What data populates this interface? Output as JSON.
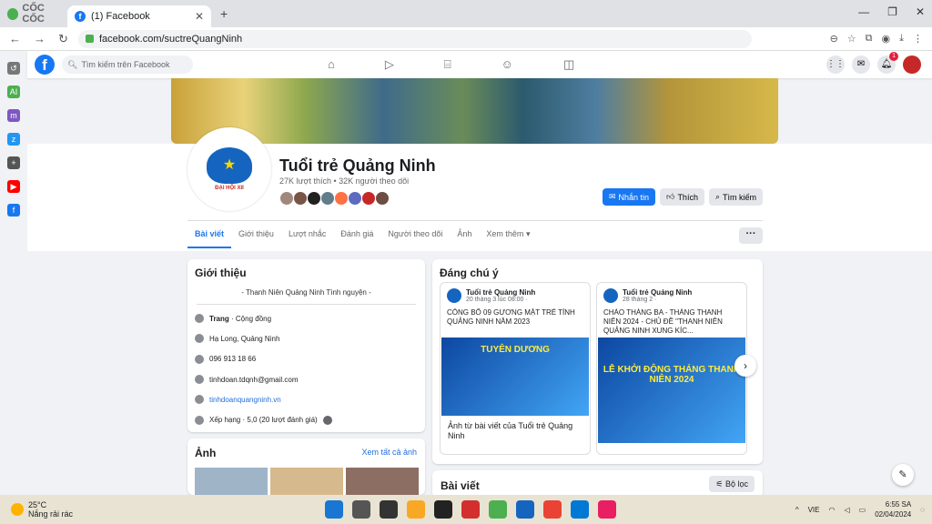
{
  "browser": {
    "brand": "CỐC CỐC",
    "tab_title": "(1) Facebook",
    "url": "facebook.com/suctreQuangNinh"
  },
  "facebook": {
    "search_placeholder": "Tìm kiếm trên Facebook",
    "notif_count": "1"
  },
  "page": {
    "name": "Tuổi trẻ Quảng Ninh",
    "stats": "27K lượt thích • 32K người theo dõi",
    "avatar_caption": "ĐẠI HỘI XII",
    "actions": [
      "Nhắn tin",
      "Thích",
      "Tìm kiếm"
    ],
    "tabs": [
      "Bài viết",
      "Giới thiệu",
      "Lượt nhắc",
      "Đánh giá",
      "Người theo dõi",
      "Ảnh",
      "Xem thêm"
    ]
  },
  "intro": {
    "title": "Giới thiệu",
    "bio": "- Thanh Niên Quảng Ninh Tình nguyện -",
    "category_bold": "Trang",
    "category_rest": " · Cộng đồng",
    "location": "Hạ Long, Quảng Ninh",
    "phone": "096 913 18 66",
    "email": "tinhdoan.tdqnh@gmail.com",
    "website": "tinhdoanquangninh.vn",
    "rating": "Xếp hạng · 5,0 (20 lượt đánh giá)"
  },
  "photos": {
    "title": "Ảnh",
    "see_all": "Xem tất cả ảnh"
  },
  "pinned": {
    "title": "Đáng chú ý",
    "cards": [
      {
        "author": "Tuổi trẻ Quảng Ninh",
        "date": "20 tháng 3 lúc 08:00 ·",
        "text": "CÔNG BỐ 09 GƯƠNG MẶT TRẺ TỈNH QUẢNG NINH NĂM 2023",
        "image_text": "TUYÊN DƯƠNG",
        "caption": "Ảnh từ bài viết của Tuổi trẻ Quảng Ninh"
      },
      {
        "author": "Tuổi trẻ Quảng Ninh",
        "date": "28 tháng 2 ·",
        "text": "CHÀO THÁNG BA - THÁNG THANH NIÊN 2024 - CHỦ ĐỀ \"THANH NIÊN QUẢNG NINH XUNG KÍC...",
        "image_text": "LỄ KHỞI ĐỘNG THÁNG THANH NIÊN 2024",
        "caption": ""
      }
    ]
  },
  "posts": {
    "title": "Bài viết",
    "filter": "Bộ lọc"
  },
  "taskbar": {
    "temp": "25°C",
    "weather": "Nắng rải rác",
    "lang": "VIE",
    "time": "6:55 SA",
    "date": "02/04/2024"
  }
}
